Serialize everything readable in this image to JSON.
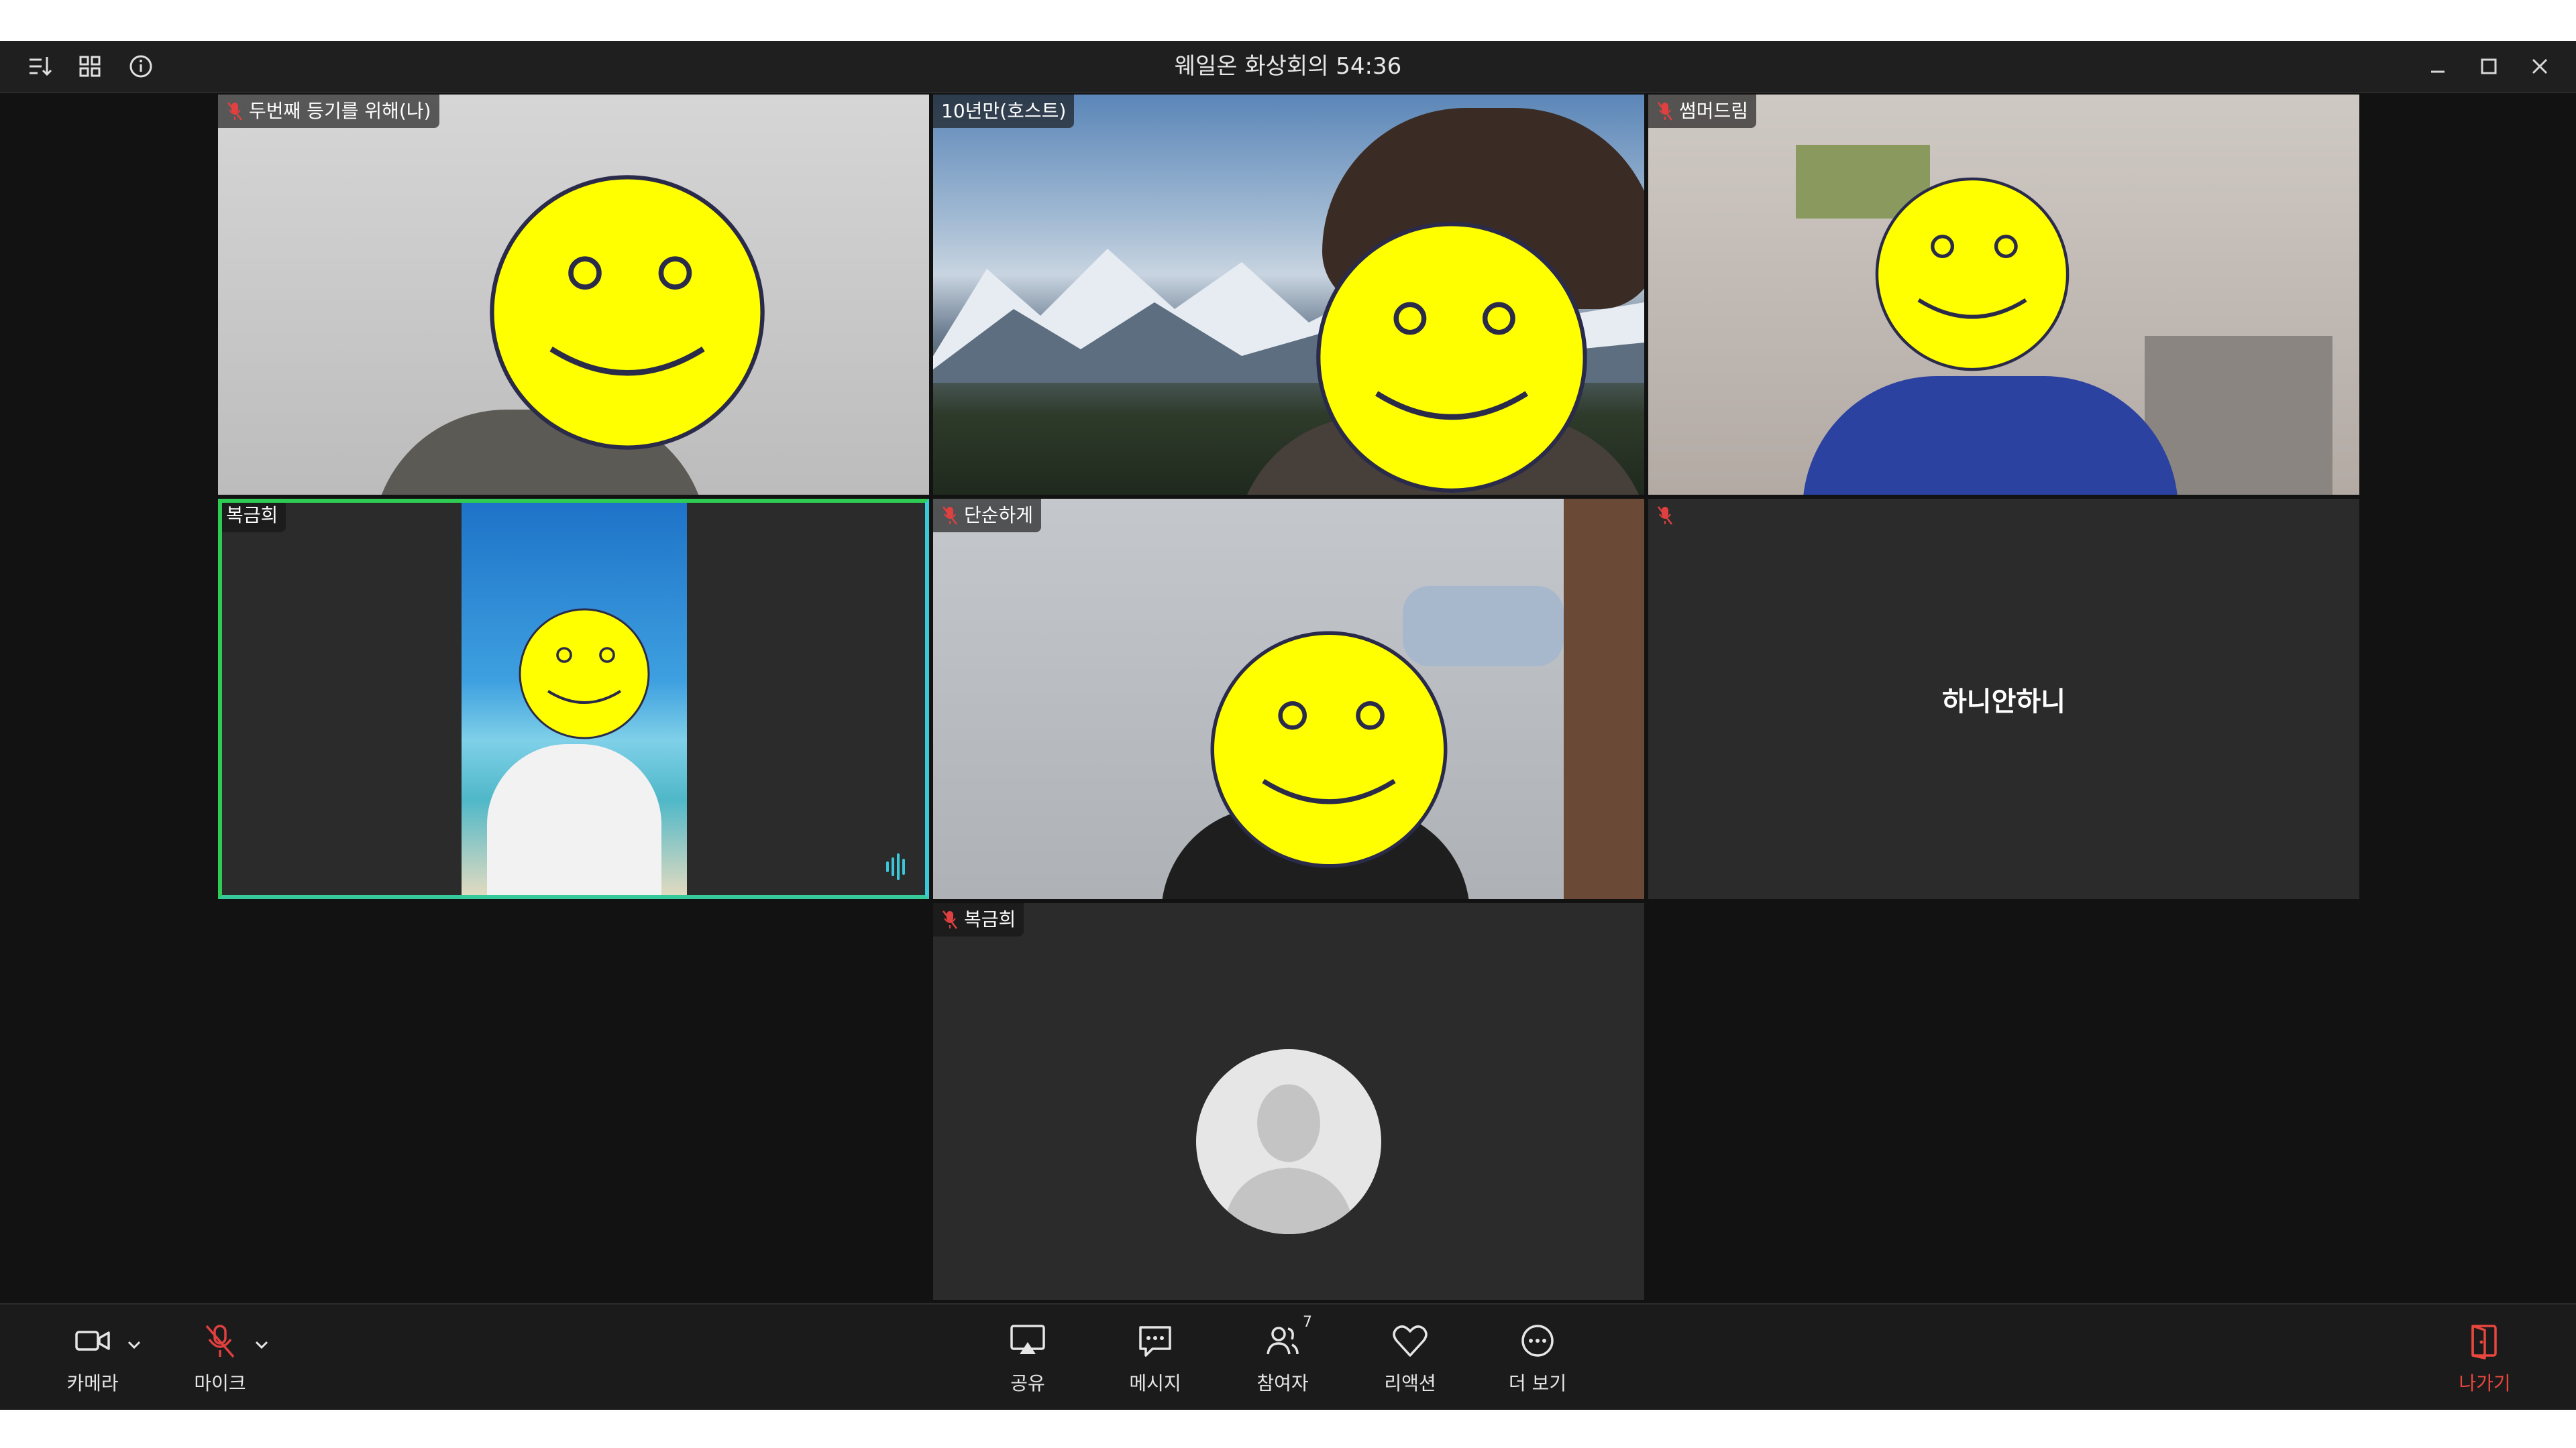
{
  "titlebar": {
    "title": "웨일온 화상회의 54:36",
    "left_icons": [
      "sort-icon",
      "grid-icon",
      "info-icon"
    ],
    "window_controls": [
      "minimize-icon",
      "maximize-icon",
      "close-icon"
    ]
  },
  "tiles": [
    {
      "name": "두번째 등기를 위해(나)",
      "muted": true
    },
    {
      "name": "10년만(호스트)",
      "muted": false
    },
    {
      "name": "썸머드림",
      "muted": true
    },
    {
      "name": "복금희",
      "muted": false,
      "active_speaker": true
    },
    {
      "name": "단순하게",
      "muted": true
    },
    {
      "name": "",
      "muted": true,
      "center_label": "하니안하니"
    },
    {
      "name": "복금희",
      "muted": true
    }
  ],
  "toolbar": {
    "camera": "카메라",
    "mic": "마이크",
    "share": "공유",
    "message": "메시지",
    "participants": "참여자",
    "participants_count": "7",
    "reaction": "리액션",
    "more": "더 보기",
    "leave": "나가기"
  },
  "colors": {
    "active_border_green": "#2ecc55",
    "active_border_cyan": "#3ac8d8",
    "leave_red": "#e8473e",
    "smiley_yellow": "#ffff00"
  }
}
